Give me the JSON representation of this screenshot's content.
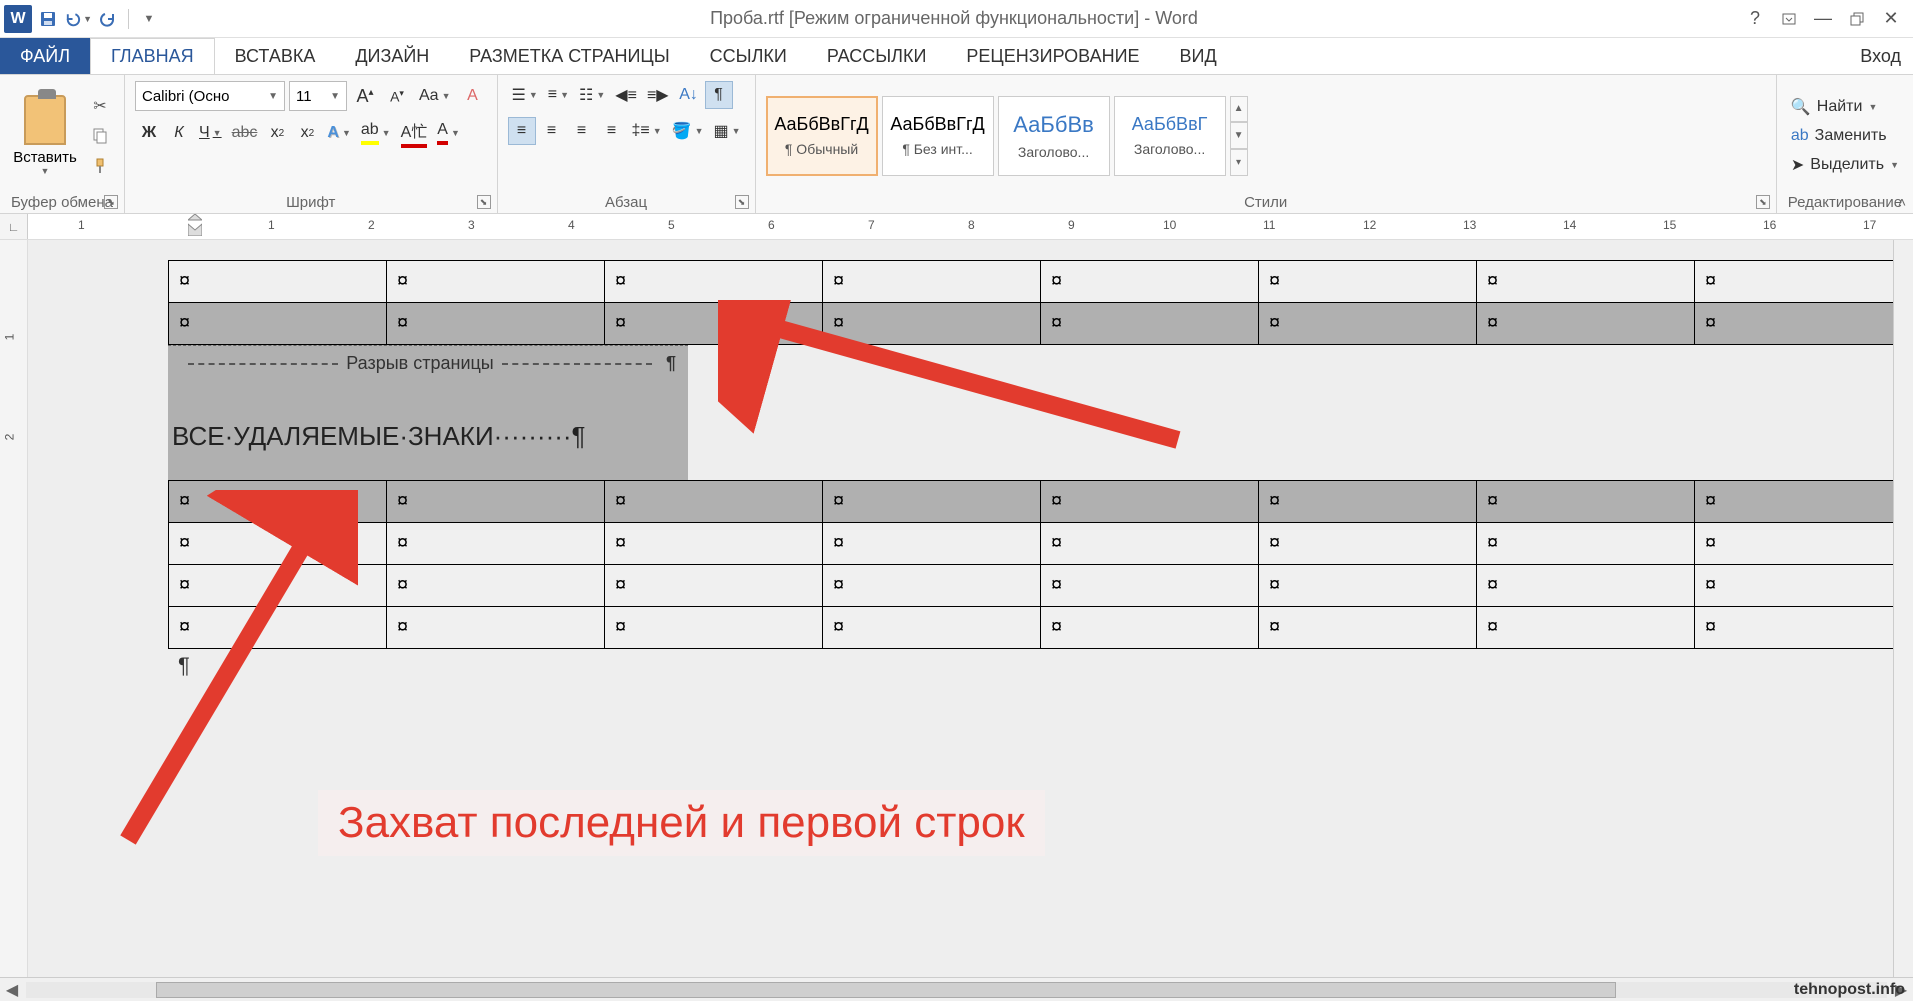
{
  "title": "Проба.rtf [Режим ограниченной функциональности] - Word",
  "qat": {
    "save": "💾",
    "undo": "↶",
    "redo": "↻"
  },
  "login": "Вход",
  "tabs": {
    "file": "ФАЙЛ",
    "home": "ГЛАВНАЯ",
    "insert": "ВСТАВКА",
    "design": "ДИЗАЙН",
    "layout": "РАЗМЕТКА СТРАНИЦЫ",
    "refs": "ССЫЛКИ",
    "mail": "РАССЫЛКИ",
    "review": "РЕЦЕНЗИРОВАНИЕ",
    "view": "ВИД"
  },
  "ribbon": {
    "clipboard": {
      "paste": "Вставить",
      "label": "Буфер обмена"
    },
    "font": {
      "name": "Calibri (Осно",
      "size": "11",
      "label": "Шрифт",
      "bold": "Ж",
      "italic": "К",
      "uline": "Ч",
      "strike": "abc",
      "sub": "x₂",
      "sup": "x²",
      "grow": "A",
      "shrink": "A",
      "case": "Aa",
      "clear": "A",
      "highlight": "ab",
      "color": "А"
    },
    "para": {
      "label": "Абзац"
    },
    "styles": {
      "label": "Стили",
      "items": [
        {
          "sample": "АаБбВвГгД",
          "name": "¶ Обычный",
          "color": "#333"
        },
        {
          "sample": "АаБбВвГгД",
          "name": "¶ Без инт...",
          "color": "#333"
        },
        {
          "sample": "АаБбВв",
          "name": "Заголово...",
          "color": "#3a78c4"
        },
        {
          "sample": "АаБбВвГ",
          "name": "Заголово...",
          "color": "#3a78c4"
        }
      ]
    },
    "edit": {
      "label": "Редактирование",
      "find": "Найти",
      "replace": "Заменить",
      "select": "Выделить"
    }
  },
  "ruler": {
    "nums": [
      "1",
      "1",
      "2",
      "3",
      "4",
      "5",
      "6",
      "7",
      "8",
      "9",
      "10",
      "11",
      "12",
      "13",
      "14",
      "15",
      "16",
      "17"
    ]
  },
  "doc": {
    "cell_mark": "¤",
    "page_break": "Разрыв страницы",
    "pilcrow": "¶",
    "heading": "ВСЕ·УДАЛЯЕМЫЕ·ЗНАКИ·········¶"
  },
  "annotation": {
    "callout": "Захват последней и первой строк",
    "watermark": "tehnopost.info"
  }
}
